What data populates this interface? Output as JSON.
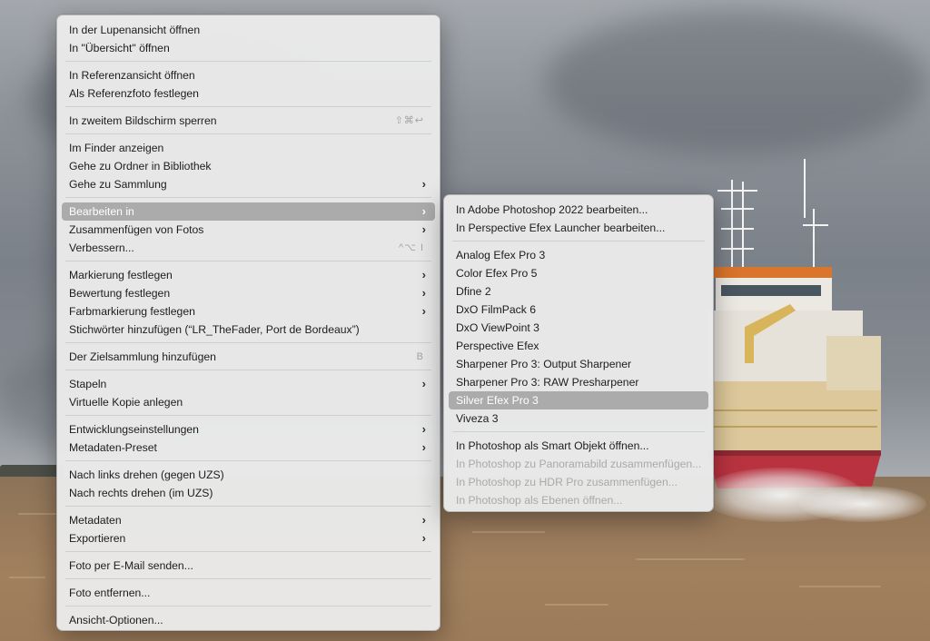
{
  "main_menu": {
    "groups": [
      [
        {
          "label": "In der Lupenansicht öffnen"
        },
        {
          "label": "In \"Übersicht\" öffnen"
        }
      ],
      [
        {
          "label": "In Referenzansicht öffnen"
        },
        {
          "label": "Als Referenzfoto festlegen"
        }
      ],
      [
        {
          "label": "In zweitem Bildschirm sperren",
          "shortcut": "⇧⌘↩"
        }
      ],
      [
        {
          "label": "Im Finder anzeigen"
        },
        {
          "label": "Gehe zu Ordner in Bibliothek"
        },
        {
          "label": "Gehe zu Sammlung",
          "submenu": true
        }
      ],
      [
        {
          "label": "Bearbeiten in",
          "submenu": true,
          "highlighted": true
        },
        {
          "label": "Zusammenfügen von Fotos",
          "submenu": true
        },
        {
          "label": "Verbessern...",
          "shortcut": "^⌥ I"
        }
      ],
      [
        {
          "label": "Markierung festlegen",
          "submenu": true
        },
        {
          "label": "Bewertung festlegen",
          "submenu": true
        },
        {
          "label": "Farbmarkierung festlegen",
          "submenu": true
        },
        {
          "label": "Stichwörter hinzufügen (“LR_TheFader, Port de Bordeaux”)"
        }
      ],
      [
        {
          "label": "Der Zielsammlung hinzufügen",
          "shortcut": "B"
        }
      ],
      [
        {
          "label": "Stapeln",
          "submenu": true
        },
        {
          "label": "Virtuelle Kopie anlegen"
        }
      ],
      [
        {
          "label": "Entwicklungseinstellungen",
          "submenu": true
        },
        {
          "label": "Metadaten-Preset",
          "submenu": true
        }
      ],
      [
        {
          "label": "Nach links drehen (gegen UZS)"
        },
        {
          "label": "Nach rechts drehen (im UZS)"
        }
      ],
      [
        {
          "label": "Metadaten",
          "submenu": true
        },
        {
          "label": "Exportieren",
          "submenu": true
        }
      ],
      [
        {
          "label": "Foto per E-Mail senden..."
        }
      ],
      [
        {
          "label": "Foto entfernen..."
        }
      ],
      [
        {
          "label": "Ansicht-Optionen..."
        }
      ]
    ]
  },
  "sub_menu": {
    "groups": [
      [
        {
          "label": "In Adobe Photoshop 2022 bearbeiten..."
        },
        {
          "label": "In Perspective Efex Launcher bearbeiten..."
        }
      ],
      [
        {
          "label": "Analog Efex Pro 3"
        },
        {
          "label": "Color Efex Pro 5"
        },
        {
          "label": "Dfine 2"
        },
        {
          "label": "DxO FilmPack 6"
        },
        {
          "label": "DxO ViewPoint 3"
        },
        {
          "label": "Perspective Efex"
        },
        {
          "label": "Sharpener Pro 3: Output Sharpener"
        },
        {
          "label": "Sharpener Pro 3: RAW Presharpener"
        },
        {
          "label": "Silver Efex Pro 3",
          "highlighted": true
        },
        {
          "label": "Viveza 3"
        }
      ],
      [
        {
          "label": "In Photoshop als Smart Objekt öffnen..."
        },
        {
          "label": "In Photoshop zu Panoramabild zusammenfügen...",
          "disabled": true
        },
        {
          "label": "In Photoshop zu HDR Pro zusammenfügen...",
          "disabled": true
        },
        {
          "label": "In Photoshop als Ebenen öffnen...",
          "disabled": true
        }
      ]
    ]
  },
  "icons": {
    "submenu_chevron": "chevron-right-icon"
  },
  "colors": {
    "menu_bg": "#e9e9e9",
    "highlight": "#ababab",
    "disabled_text": "#a9a9a9"
  }
}
